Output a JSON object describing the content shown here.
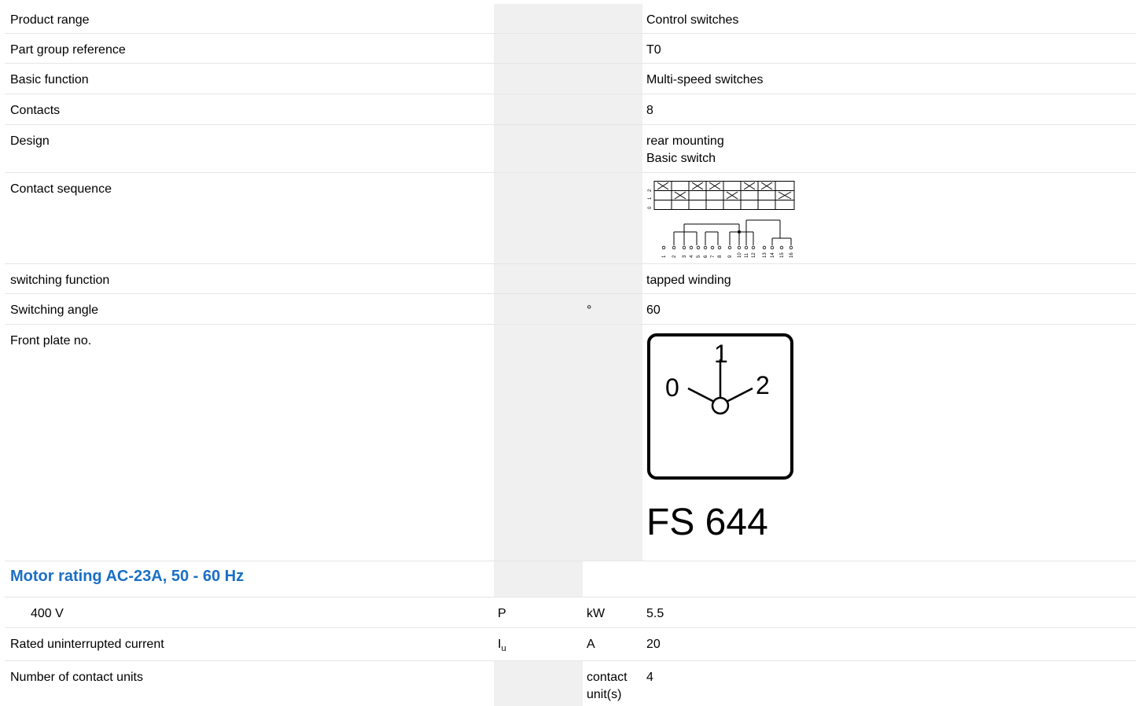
{
  "rows": [
    {
      "label": "Product range",
      "symbol": "",
      "unit": "",
      "value": "Control switches"
    },
    {
      "label": "Part group reference",
      "symbol": "",
      "unit": "",
      "value": "T0"
    },
    {
      "label": "Basic function",
      "symbol": "",
      "unit": "",
      "value": "Multi-speed switches"
    },
    {
      "label": "Contacts",
      "symbol": "",
      "unit": "",
      "value": "8"
    },
    {
      "label": "Design",
      "symbol": "",
      "unit": "",
      "value_line1": "rear mounting",
      "value_line2": "Basic switch"
    },
    {
      "label": "Contact sequence"
    },
    {
      "label": "switching function",
      "symbol": "",
      "unit": "",
      "value": "tapped winding"
    },
    {
      "label": "Switching angle",
      "symbol": "",
      "unit": "°",
      "value": "60"
    },
    {
      "label": "Front plate no.",
      "front_plate": {
        "position_0": "0",
        "position_1": "1",
        "position_2": "2",
        "code": "FS 644"
      }
    },
    {
      "section": "Motor rating AC-23A, 50 - 60 Hz"
    },
    {
      "label": "400 V",
      "symbol": "P",
      "unit": "kW",
      "value": "5.5"
    },
    {
      "label": "Rated uninterrupted current",
      "symbol_main": "I",
      "symbol_sub": "u",
      "unit": "A",
      "value": "20"
    },
    {
      "label": "Number of contact units",
      "symbol": "",
      "unit_line1": "contact",
      "unit_line2": "unit(s)",
      "value": "4"
    }
  ],
  "contact_sequence": {
    "positions": [
      "0",
      "1",
      "2"
    ],
    "terminals": [
      "1",
      "2",
      "3",
      "4",
      "5",
      "6",
      "7",
      "8",
      "9",
      "10",
      "11",
      "12",
      "13",
      "14",
      "15",
      "16"
    ]
  }
}
